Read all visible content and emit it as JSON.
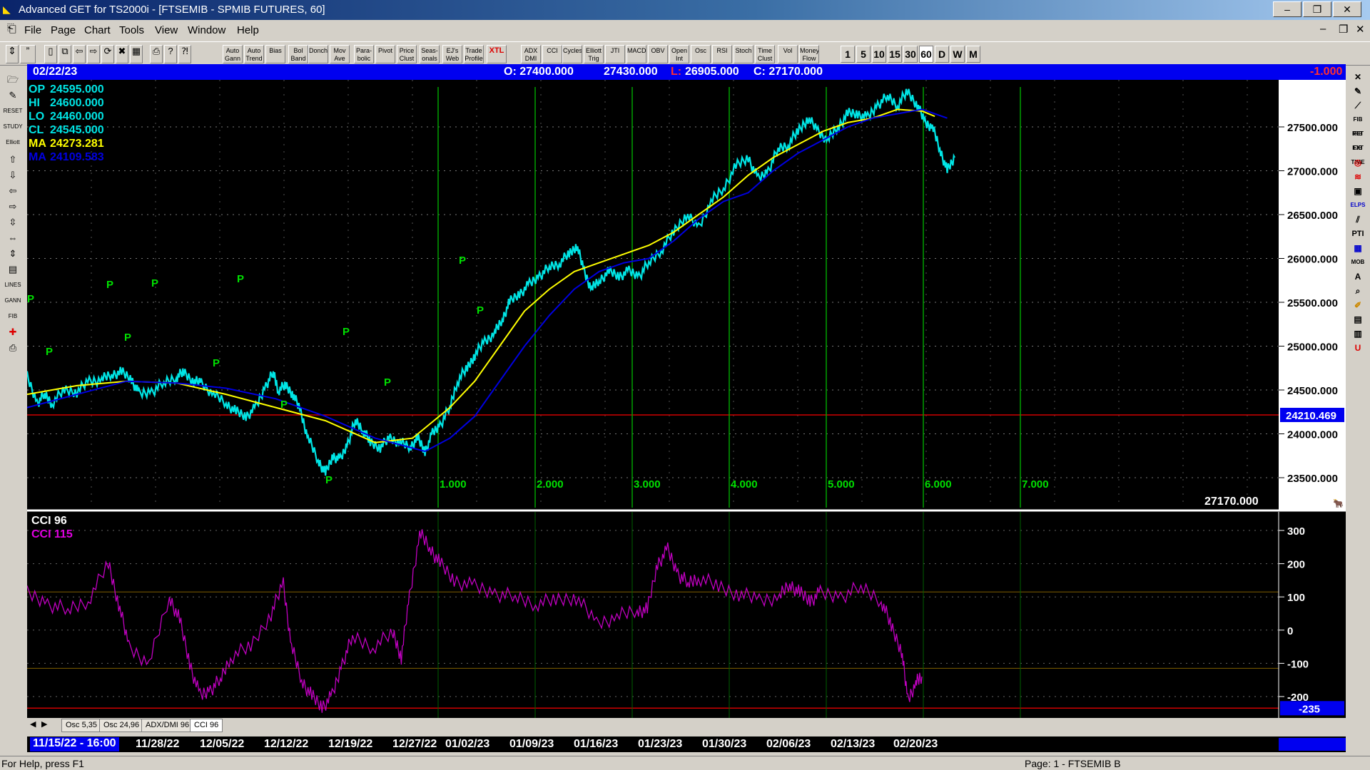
{
  "window": {
    "title": "Advanced GET for TS2000i - [FTSEMIB - SPMIB FUTURES, 60]",
    "min": "–",
    "max": "❐",
    "close": "✕",
    "doc_min": "–",
    "doc_restore": "❐",
    "doc_close": "✕"
  },
  "menu": [
    "File",
    "Page",
    "Chart",
    "Tools",
    "View",
    "Window",
    "Help"
  ],
  "toolbar": {
    "buttons": [
      "Auto Gann",
      "Auto Trend",
      "Bias",
      "Bol Band",
      "Donch",
      "Mov Ave",
      "Para- bolic",
      "Pivot",
      "Price Clust",
      "Seas- onals",
      "EJ's Web",
      "Trade Profile",
      "XTL",
      "ADX DMI",
      "CCI",
      "Cycles",
      "Elliott Trig",
      "JTI",
      "MACD",
      "OBV",
      "Open Int",
      "Osc",
      "RSI",
      "Stoch",
      "Time Clust",
      "Vol",
      "Money Flow"
    ],
    "intervals": [
      "1",
      "5",
      "10",
      "15",
      "30",
      "60",
      "D",
      "W",
      "M"
    ]
  },
  "header": {
    "date": "02/22/23",
    "open": "O: 27400.000",
    "high": "27430.000",
    "low_label": "L:",
    "low": "26905.000",
    "close": "C: 27170.000",
    "change": "-1.000"
  },
  "legend": [
    {
      "label": "OP",
      "value": "24595.000"
    },
    {
      "label": "HI",
      "value": "24600.000"
    },
    {
      "label": "LO",
      "value": "24460.000"
    },
    {
      "label": "CL",
      "value": "24545.000"
    },
    {
      "label": "MA",
      "value": "24273.281"
    },
    {
      "label": "MA",
      "value": "24109.583"
    }
  ],
  "price_axis": [
    "27500.000",
    "27000.000",
    "26500.000",
    "26000.000",
    "25500.000",
    "25000.000",
    "24500.000",
    "24000.000",
    "23500.000"
  ],
  "price_marker": "24210.469",
  "last_price": "27170.000",
  "cycle_labels": [
    "1.000",
    "2.000",
    "3.000",
    "4.000",
    "5.000",
    "6.000",
    "7.000"
  ],
  "osc": {
    "title": "CCI 96",
    "sub": "CCI  115",
    "axis": [
      "300",
      "200",
      "100",
      "0",
      "-100",
      "-200"
    ],
    "marker": "-235"
  },
  "tabs": [
    "Osc 5,35",
    "Osc 24,96",
    "ADX/DMI 96",
    "CCI 96"
  ],
  "dates": [
    "11/15/22 - 16:00",
    "11/28/22",
    "12/05/22",
    "12/12/22",
    "12/19/22",
    "12/27/22",
    "01/02/23",
    "01/09/23",
    "01/16/23",
    "01/23/23",
    "01/30/23",
    "02/06/23",
    "02/13/23",
    "02/20/23"
  ],
  "status": {
    "help": "For Help, press F1",
    "page": "Page: 1 - FTSEMIB B"
  },
  "colors": {
    "price": "#00e5e5",
    "ma_fast": "#ffff00",
    "ma_slow": "#0000e0",
    "cycle": "#00a000",
    "pivot": "#00e000",
    "cci": "#c000c0",
    "ohlc_bar": "#0000f0"
  },
  "chart_data": {
    "type": "line",
    "x_ticks": [
      "11/15/22",
      "11/28/22",
      "12/05/22",
      "12/12/22",
      "12/19/22",
      "12/27/22",
      "01/02/23",
      "01/09/23",
      "01/16/23",
      "01/23/23",
      "01/30/23",
      "02/06/23",
      "02/13/23",
      "02/20/23"
    ],
    "ylim": [
      23300,
      27950
    ],
    "series": [
      {
        "key": "price",
        "points": [
          [
            0,
            24650
          ],
          [
            0.4,
            24350
          ],
          [
            0.7,
            24450
          ],
          [
            1,
            24350
          ],
          [
            1.5,
            24500
          ],
          [
            2,
            24480
          ],
          [
            2.5,
            24600
          ],
          [
            3,
            24620
          ],
          [
            3.4,
            24680
          ],
          [
            3.8,
            24700
          ],
          [
            4.2,
            24620
          ],
          [
            4.5,
            24450
          ],
          [
            5,
            24480
          ],
          [
            5.5,
            24580
          ],
          [
            6,
            24650
          ],
          [
            6.3,
            24700
          ],
          [
            6.7,
            24600
          ],
          [
            7,
            24580
          ],
          [
            7.5,
            24450
          ],
          [
            8,
            24350
          ],
          [
            8.4,
            24250
          ],
          [
            8.8,
            24200
          ],
          [
            9.2,
            24300
          ],
          [
            9.6,
            24550
          ],
          [
            9.9,
            24700
          ],
          [
            10.1,
            24500
          ],
          [
            10.4,
            24550
          ],
          [
            10.7,
            24450
          ],
          [
            11,
            24250
          ],
          [
            11.3,
            23950
          ],
          [
            11.7,
            23700
          ],
          [
            12,
            23550
          ],
          [
            12.3,
            23750
          ],
          [
            12.6,
            23700
          ],
          [
            12.9,
            23900
          ],
          [
            13.2,
            24150
          ],
          [
            13.5,
            24050
          ],
          [
            13.8,
            23900
          ],
          [
            14.2,
            23850
          ],
          [
            14.6,
            23950
          ],
          [
            15,
            23900
          ],
          [
            15.4,
            23850
          ],
          [
            15.7,
            23950
          ],
          [
            16,
            23800
          ],
          [
            16.3,
            24000
          ],
          [
            16.6,
            24100
          ],
          [
            17,
            24300
          ],
          [
            17.3,
            24600
          ],
          [
            17.7,
            24750
          ],
          [
            18,
            24900
          ],
          [
            18.4,
            25050
          ],
          [
            18.8,
            25150
          ],
          [
            19.1,
            25300
          ],
          [
            19.4,
            25500
          ],
          [
            19.8,
            25600
          ],
          [
            20.2,
            25700
          ],
          [
            20.6,
            25800
          ],
          [
            21,
            25900
          ],
          [
            21.4,
            25950
          ],
          [
            21.8,
            26050
          ],
          [
            22.1,
            26150
          ],
          [
            22.4,
            25850
          ],
          [
            22.7,
            25650
          ],
          [
            23,
            25750
          ],
          [
            23.4,
            25850
          ],
          [
            23.8,
            25800
          ],
          [
            24.2,
            25850
          ],
          [
            24.6,
            25800
          ],
          [
            25,
            25950
          ],
          [
            25.5,
            26100
          ],
          [
            26,
            26300
          ],
          [
            26.5,
            26500
          ],
          [
            27,
            26350
          ],
          [
            27.5,
            26650
          ],
          [
            28,
            26800
          ],
          [
            28.5,
            27050
          ],
          [
            29,
            27150
          ],
          [
            29.4,
            26900
          ],
          [
            29.8,
            27000
          ],
          [
            30.2,
            27250
          ],
          [
            30.6,
            27300
          ],
          [
            31,
            27450
          ],
          [
            31.4,
            27600
          ],
          [
            31.8,
            27450
          ],
          [
            32.2,
            27350
          ],
          [
            32.6,
            27500
          ],
          [
            33,
            27650
          ],
          [
            33.4,
            27650
          ],
          [
            33.8,
            27600
          ],
          [
            34.2,
            27750
          ],
          [
            34.6,
            27850
          ],
          [
            35,
            27750
          ],
          [
            35.4,
            27900
          ],
          [
            35.8,
            27750
          ],
          [
            36.1,
            27550
          ],
          [
            36.4,
            27500
          ],
          [
            36.7,
            27250
          ],
          [
            37,
            27000
          ],
          [
            37.3,
            27150
          ]
        ]
      },
      {
        "key": "ma_fast",
        "points": [
          [
            0,
            24450
          ],
          [
            2,
            24550
          ],
          [
            4,
            24600
          ],
          [
            6,
            24580
          ],
          [
            8,
            24450
          ],
          [
            10,
            24300
          ],
          [
            12,
            24150
          ],
          [
            14,
            23900
          ],
          [
            15.5,
            23950
          ],
          [
            17,
            24300
          ],
          [
            18,
            24600
          ],
          [
            19,
            25000
          ],
          [
            20,
            25400
          ],
          [
            21,
            25650
          ],
          [
            22,
            25850
          ],
          [
            23,
            25950
          ],
          [
            24,
            26050
          ],
          [
            25,
            26150
          ],
          [
            26,
            26300
          ],
          [
            27,
            26500
          ],
          [
            28,
            26700
          ],
          [
            29,
            26950
          ],
          [
            30,
            27150
          ],
          [
            31,
            27300
          ],
          [
            32,
            27450
          ],
          [
            33,
            27550
          ],
          [
            34,
            27600
          ],
          [
            35,
            27700
          ],
          [
            36,
            27680
          ],
          [
            36.5,
            27620
          ]
        ]
      },
      {
        "key": "ma_slow",
        "points": [
          [
            0,
            24300
          ],
          [
            2,
            24450
          ],
          [
            4,
            24600
          ],
          [
            6,
            24580
          ],
          [
            8,
            24520
          ],
          [
            10,
            24400
          ],
          [
            12,
            24200
          ],
          [
            14,
            23950
          ],
          [
            16,
            23800
          ],
          [
            17,
            23950
          ],
          [
            18,
            24200
          ],
          [
            19,
            24600
          ],
          [
            20,
            25000
          ],
          [
            21,
            25350
          ],
          [
            22,
            25650
          ],
          [
            23,
            25850
          ],
          [
            24,
            25950
          ],
          [
            25,
            26000
          ],
          [
            26,
            26200
          ],
          [
            27,
            26450
          ],
          [
            28,
            26650
          ],
          [
            29,
            26750
          ],
          [
            30,
            27000
          ],
          [
            31,
            27200
          ],
          [
            32,
            27350
          ],
          [
            33,
            27500
          ],
          [
            34,
            27600
          ],
          [
            35,
            27650
          ],
          [
            36,
            27700
          ],
          [
            37,
            27600
          ]
        ]
      },
      {
        "key": "cci",
        "points": [
          [
            0,
            110
          ],
          [
            1,
            80
          ],
          [
            2,
            60
          ],
          [
            3,
            90
          ],
          [
            4,
            200
          ],
          [
            4.5,
            80
          ],
          [
            5,
            -50
          ],
          [
            6,
            -100
          ],
          [
            7,
            100
          ],
          [
            7.5,
            30
          ],
          [
            8,
            -100
          ],
          [
            8.5,
            -200
          ],
          [
            9,
            -180
          ],
          [
            9.5,
            -150
          ],
          [
            10,
            -80
          ],
          [
            11,
            -50
          ],
          [
            12,
            50
          ],
          [
            12.6,
            140
          ],
          [
            13,
            -50
          ],
          [
            13.5,
            -150
          ],
          [
            14,
            -200
          ],
          [
            14.5,
            -230
          ],
          [
            15,
            -200
          ],
          [
            15.5,
            -100
          ],
          [
            16,
            -20
          ],
          [
            17,
            -50
          ],
          [
            18,
            -10
          ],
          [
            18.4,
            -80
          ],
          [
            18.8,
            100
          ],
          [
            19.3,
            290
          ],
          [
            19.8,
            250
          ],
          [
            20.3,
            200
          ],
          [
            21,
            150
          ],
          [
            22,
            130
          ],
          [
            23,
            110
          ],
          [
            24,
            100
          ],
          [
            25,
            80
          ],
          [
            26,
            90
          ],
          [
            27,
            100
          ],
          [
            28,
            20
          ],
          [
            29,
            40
          ],
          [
            30,
            60
          ],
          [
            30.5,
            60
          ],
          [
            31,
            200
          ],
          [
            31.5,
            240
          ],
          [
            32,
            170
          ],
          [
            32.5,
            140
          ],
          [
            33,
            160
          ],
          [
            34,
            130
          ],
          [
            35,
            110
          ],
          [
            36,
            90
          ],
          [
            37,
            100
          ],
          [
            37.5,
            140
          ],
          [
            38,
            110
          ],
          [
            38.5,
            90
          ],
          [
            39,
            110
          ],
          [
            40,
            100
          ],
          [
            41,
            130
          ],
          [
            42,
            90
          ],
          [
            42.5,
            10
          ],
          [
            43,
            -60
          ],
          [
            43.3,
            -210
          ],
          [
            43.7,
            -160
          ],
          [
            44,
            -140
          ]
        ]
      }
    ]
  }
}
